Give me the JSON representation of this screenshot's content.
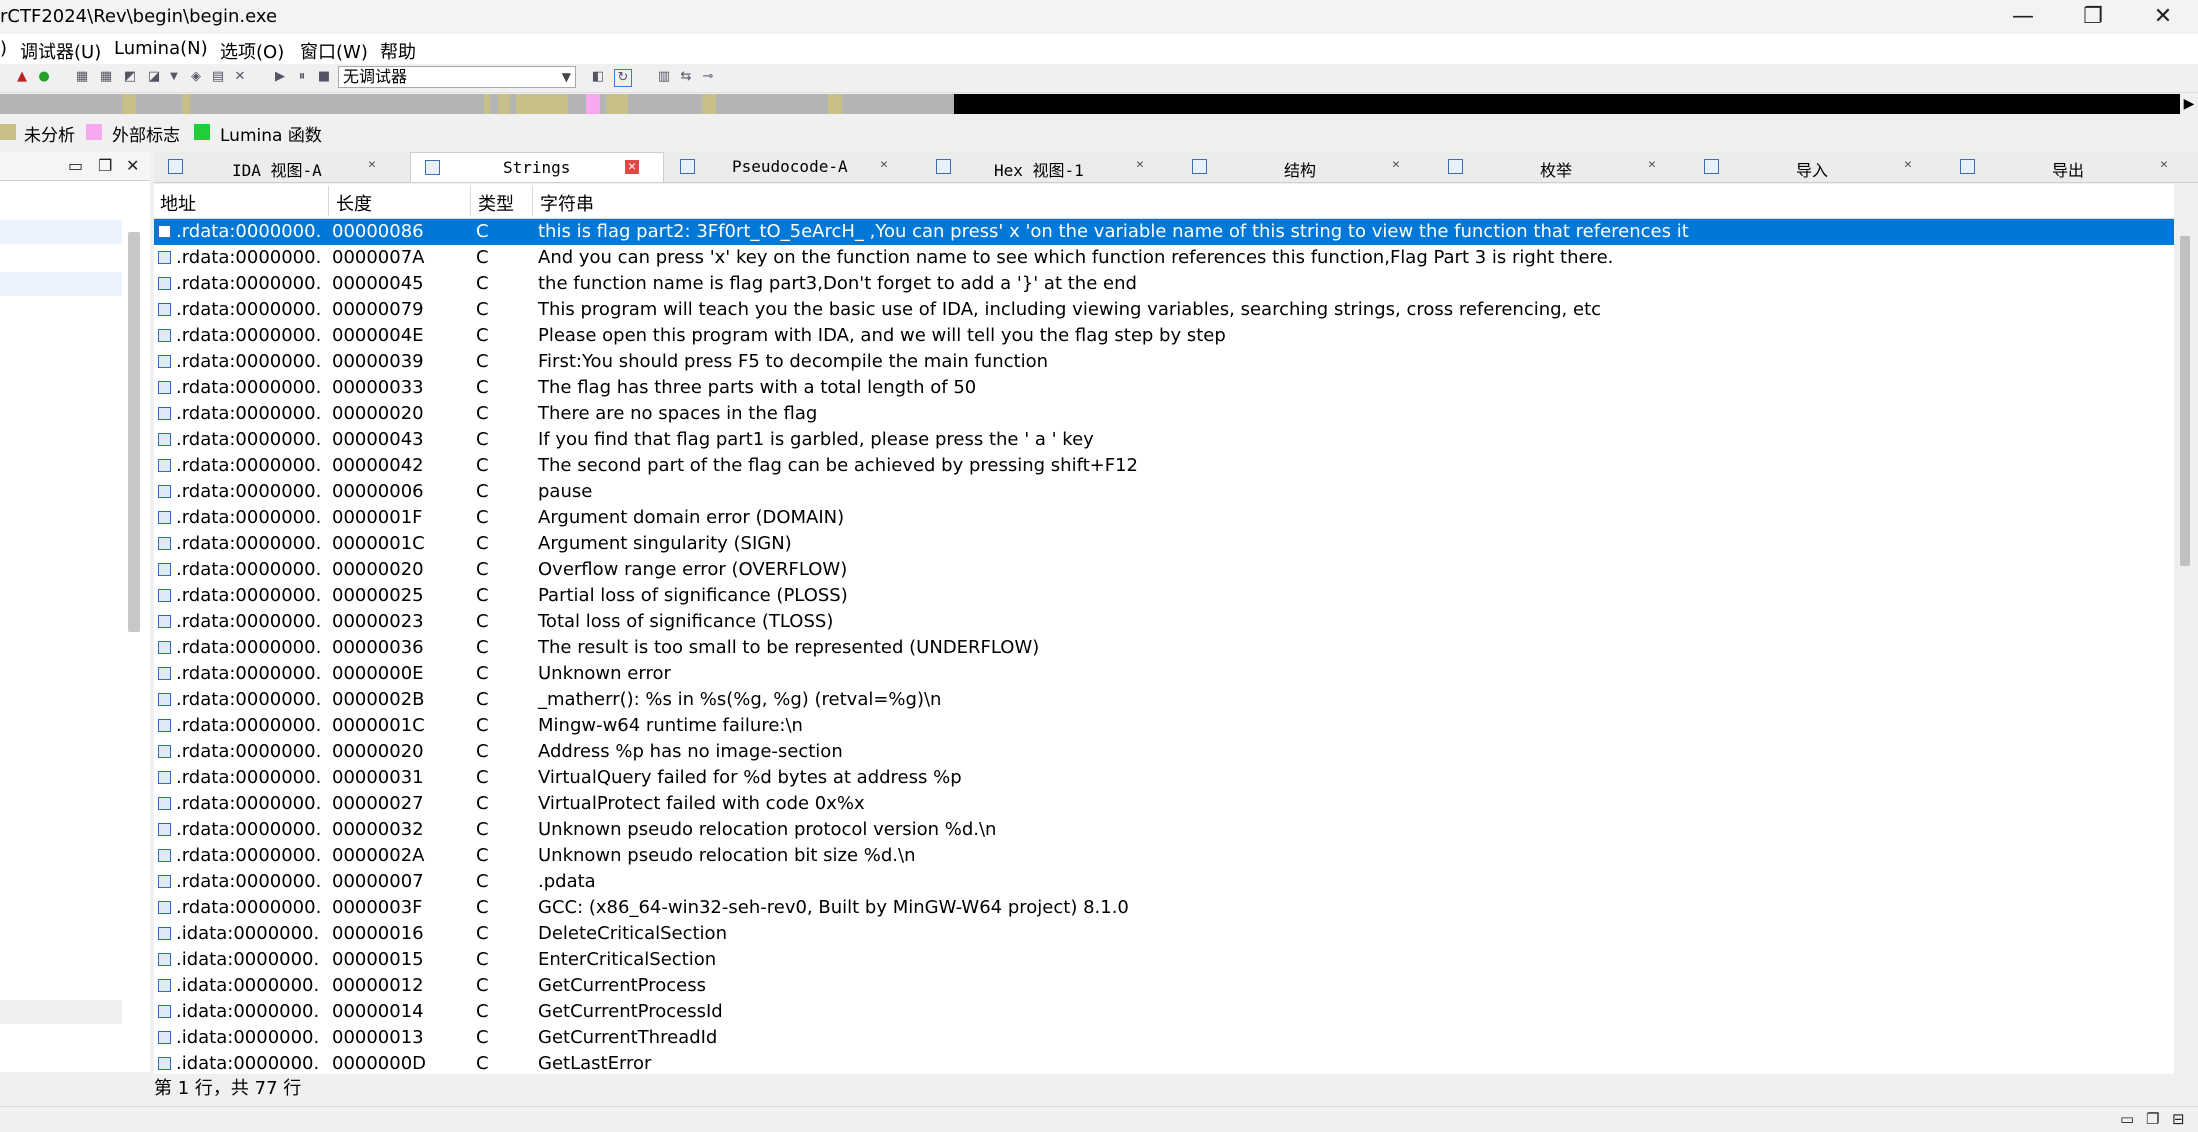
{
  "window": {
    "title": "rCTF2024\\Rev\\begin\\begin.exe",
    "minimize": "—",
    "maximize": "❐",
    "close": "✕"
  },
  "menu": [
    "调试器(U)",
    "Lumina(N)",
    "选项(O)",
    "窗口(W)",
    "帮助"
  ],
  "menu_lead": ")",
  "toolbar": {
    "debugger_combo": "无调试器"
  },
  "legend": [
    {
      "label": "未分析",
      "color": "#c8c089"
    },
    {
      "label": "外部标志",
      "color": "#f7a8f0"
    },
    {
      "label": "Lumina 函数",
      "color": "#1fcf3a"
    }
  ],
  "tabs": [
    {
      "label": "IDA 视图-A",
      "close": "✕"
    },
    {
      "label": "Strings",
      "close": "✕"
    },
    {
      "label": "Pseudocode-A",
      "close": "✕"
    },
    {
      "label": "Hex 视图-1",
      "close": "✕"
    },
    {
      "label": "结构",
      "close": "✕"
    },
    {
      "label": "枚举",
      "close": "✕"
    },
    {
      "label": "导入",
      "close": "✕"
    },
    {
      "label": "导出",
      "close": "✕"
    }
  ],
  "table": {
    "columns": [
      "地址",
      "长度",
      "类型",
      "字符串"
    ],
    "rows": [
      {
        "addr": ".rdata:0000000...",
        "len": "00000086",
        "type": "C",
        "str": "this is flag part2: 3Ff0rt_tO_5eArcH_ ,You can press' x 'on the variable name of this string to view the function that references it"
      },
      {
        "addr": ".rdata:0000000...",
        "len": "0000007A",
        "type": "C",
        "str": "And you can press 'x' key on the function name to see which function references this function,Flag Part 3 is right there."
      },
      {
        "addr": ".rdata:0000000...",
        "len": "00000045",
        "type": "C",
        "str": "the function name is flag part3,Don't forget to add a '}' at the end"
      },
      {
        "addr": ".rdata:0000000...",
        "len": "00000079",
        "type": "C",
        "str": "This program will teach you the basic use of IDA, including viewing variables, searching strings, cross referencing, etc"
      },
      {
        "addr": ".rdata:0000000...",
        "len": "0000004E",
        "type": "C",
        "str": "Please open this program with IDA, and we will tell you the flag step by step"
      },
      {
        "addr": ".rdata:0000000...",
        "len": "00000039",
        "type": "C",
        "str": "First:You should press F5 to decompile the main function"
      },
      {
        "addr": ".rdata:0000000...",
        "len": "00000033",
        "type": "C",
        "str": "The flag has three parts with a total length of 50"
      },
      {
        "addr": ".rdata:0000000...",
        "len": "00000020",
        "type": "C",
        "str": "There are no spaces in the flag"
      },
      {
        "addr": ".rdata:0000000...",
        "len": "00000043",
        "type": "C",
        "str": "If you find that flag part1 is garbled, please press the ' a ' key"
      },
      {
        "addr": ".rdata:0000000...",
        "len": "00000042",
        "type": "C",
        "str": "The second part of the flag can be achieved by pressing shift+F12"
      },
      {
        "addr": ".rdata:0000000...",
        "len": "00000006",
        "type": "C",
        "str": "pause"
      },
      {
        "addr": ".rdata:0000000...",
        "len": "0000001F",
        "type": "C",
        "str": "Argument domain error (DOMAIN)"
      },
      {
        "addr": ".rdata:0000000...",
        "len": "0000001C",
        "type": "C",
        "str": "Argument singularity (SIGN)"
      },
      {
        "addr": ".rdata:0000000...",
        "len": "00000020",
        "type": "C",
        "str": "Overflow range error (OVERFLOW)"
      },
      {
        "addr": ".rdata:0000000...",
        "len": "00000025",
        "type": "C",
        "str": "Partial loss of significance (PLOSS)"
      },
      {
        "addr": ".rdata:0000000...",
        "len": "00000023",
        "type": "C",
        "str": "Total loss of significance (TLOSS)"
      },
      {
        "addr": ".rdata:0000000...",
        "len": "00000036",
        "type": "C",
        "str": "The result is too small to be represented (UNDERFLOW)"
      },
      {
        "addr": ".rdata:0000000...",
        "len": "0000000E",
        "type": "C",
        "str": "Unknown error"
      },
      {
        "addr": ".rdata:0000000...",
        "len": "0000002B",
        "type": "C",
        "str": "_matherr(): %s in %s(%g, %g)  (retval=%g)\\n"
      },
      {
        "addr": ".rdata:0000000...",
        "len": "0000001C",
        "type": "C",
        "str": "Mingw-w64 runtime failure:\\n"
      },
      {
        "addr": ".rdata:0000000...",
        "len": "00000020",
        "type": "C",
        "str": "Address %p has no image-section"
      },
      {
        "addr": ".rdata:0000000...",
        "len": "00000031",
        "type": "C",
        "str": "  VirtualQuery failed for %d bytes at address %p"
      },
      {
        "addr": ".rdata:0000000...",
        "len": "00000027",
        "type": "C",
        "str": "  VirtualProtect failed with code 0x%x"
      },
      {
        "addr": ".rdata:0000000...",
        "len": "00000032",
        "type": "C",
        "str": "  Unknown pseudo relocation protocol version %d.\\n"
      },
      {
        "addr": ".rdata:0000000...",
        "len": "0000002A",
        "type": "C",
        "str": "  Unknown pseudo relocation bit size %d.\\n"
      },
      {
        "addr": ".rdata:0000000...",
        "len": "00000007",
        "type": "C",
        "str": ".pdata"
      },
      {
        "addr": ".rdata:0000000...",
        "len": "0000003F",
        "type": "C",
        "str": "GCC: (x86_64-win32-seh-rev0, Built by MinGW-W64 project) 8.1.0"
      },
      {
        "addr": ".idata:0000000...",
        "len": "00000016",
        "type": "C",
        "str": "DeleteCriticalSection"
      },
      {
        "addr": ".idata:0000000...",
        "len": "00000015",
        "type": "C",
        "str": "EnterCriticalSection"
      },
      {
        "addr": ".idata:0000000...",
        "len": "00000012",
        "type": "C",
        "str": "GetCurrentProcess"
      },
      {
        "addr": ".idata:0000000...",
        "len": "00000014",
        "type": "C",
        "str": "GetCurrentProcessId"
      },
      {
        "addr": ".idata:0000000...",
        "len": "00000013",
        "type": "C",
        "str": "GetCurrentThreadId"
      },
      {
        "addr": ".idata:0000000...",
        "len": "0000000D",
        "type": "C",
        "str": "GetLastError"
      }
    ]
  },
  "status": {
    "line": "第 1 行，共 77 行"
  },
  "colors": {
    "selection": "#0078d7",
    "accent": "#2c6fb7"
  }
}
